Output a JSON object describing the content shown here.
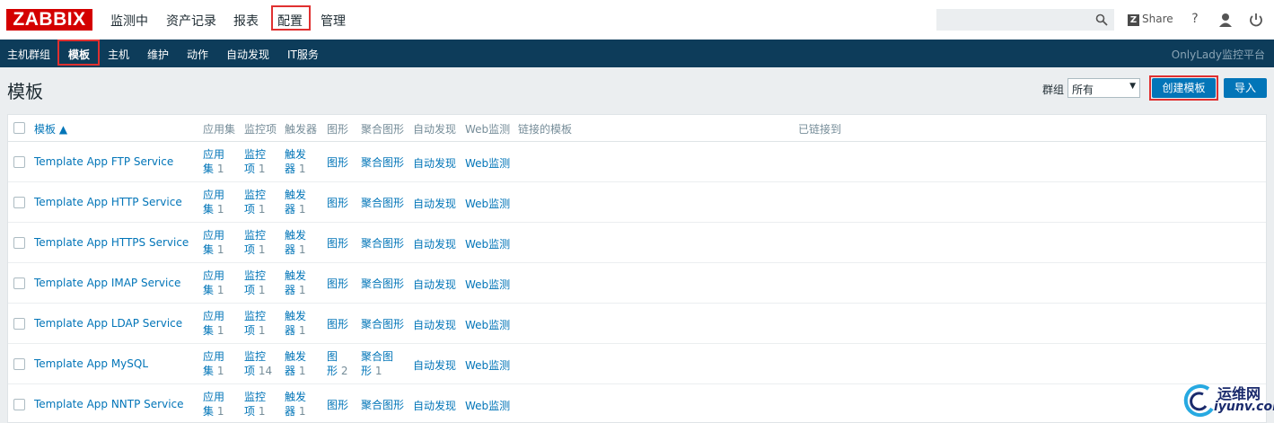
{
  "header": {
    "logo": "ZABBIX",
    "menu": [
      "监测中",
      "资产记录",
      "报表",
      "配置",
      "管理"
    ],
    "share": "Share",
    "share_badge": "Z",
    "help": "?"
  },
  "submenu": {
    "items": [
      "主机群组",
      "模板",
      "主机",
      "维护",
      "动作",
      "自动发现",
      "IT服务"
    ],
    "active": "模板",
    "brand": "OnlyLady监控平台"
  },
  "page": {
    "title": "模板",
    "filter_label": "群组",
    "filter_value": "所有",
    "create_button": "创建模板",
    "import_button": "导入"
  },
  "table": {
    "columns": [
      "模板 ▲",
      "应用集",
      "监控项",
      "触发器",
      "图形",
      "聚合图形",
      "自动发现",
      "Web监测",
      "链接的模板",
      "已链接到"
    ],
    "rows": [
      {
        "name": "Template App FTP Service",
        "apps": [
          "应用",
          "集",
          "1"
        ],
        "items": [
          "监控",
          "项",
          "1"
        ],
        "triggers": [
          "触发",
          "器",
          "1"
        ],
        "graphs": [
          "图形",
          "",
          ""
        ],
        "screens": [
          "聚合图形",
          "",
          ""
        ],
        "discovery": "自动发现",
        "web": "Web监测"
      },
      {
        "name": "Template App HTTP Service",
        "apps": [
          "应用",
          "集",
          "1"
        ],
        "items": [
          "监控",
          "项",
          "1"
        ],
        "triggers": [
          "触发",
          "器",
          "1"
        ],
        "graphs": [
          "图形",
          "",
          ""
        ],
        "screens": [
          "聚合图形",
          "",
          ""
        ],
        "discovery": "自动发现",
        "web": "Web监测"
      },
      {
        "name": "Template App HTTPS Service",
        "apps": [
          "应用",
          "集",
          "1"
        ],
        "items": [
          "监控",
          "项",
          "1"
        ],
        "triggers": [
          "触发",
          "器",
          "1"
        ],
        "graphs": [
          "图形",
          "",
          ""
        ],
        "screens": [
          "聚合图形",
          "",
          ""
        ],
        "discovery": "自动发现",
        "web": "Web监测"
      },
      {
        "name": "Template App IMAP Service",
        "apps": [
          "应用",
          "集",
          "1"
        ],
        "items": [
          "监控",
          "项",
          "1"
        ],
        "triggers": [
          "触发",
          "器",
          "1"
        ],
        "graphs": [
          "图形",
          "",
          ""
        ],
        "screens": [
          "聚合图形",
          "",
          ""
        ],
        "discovery": "自动发现",
        "web": "Web监测"
      },
      {
        "name": "Template App LDAP Service",
        "apps": [
          "应用",
          "集",
          "1"
        ],
        "items": [
          "监控",
          "项",
          "1"
        ],
        "triggers": [
          "触发",
          "器",
          "1"
        ],
        "graphs": [
          "图形",
          "",
          ""
        ],
        "screens": [
          "聚合图形",
          "",
          ""
        ],
        "discovery": "自动发现",
        "web": "Web监测"
      },
      {
        "name": "Template App MySQL",
        "apps": [
          "应用",
          "集",
          "1"
        ],
        "items": [
          "监控",
          "项",
          "14"
        ],
        "triggers": [
          "触发",
          "器",
          "1"
        ],
        "graphs": [
          "图",
          "形",
          "2"
        ],
        "screens": [
          "聚合图",
          "形",
          "1"
        ],
        "discovery": "自动发现",
        "web": "Web监测"
      },
      {
        "name": "Template App NNTP Service",
        "apps": [
          "应用",
          "集",
          "1"
        ],
        "items": [
          "监控",
          "项",
          "1"
        ],
        "triggers": [
          "触发",
          "器",
          "1"
        ],
        "graphs": [
          "图形",
          "",
          ""
        ],
        "screens": [
          "聚合图形",
          "",
          ""
        ],
        "discovery": "自动发现",
        "web": "Web监测"
      }
    ]
  },
  "watermark": {
    "line1": "运维网",
    "line2": "iyunv.com"
  }
}
